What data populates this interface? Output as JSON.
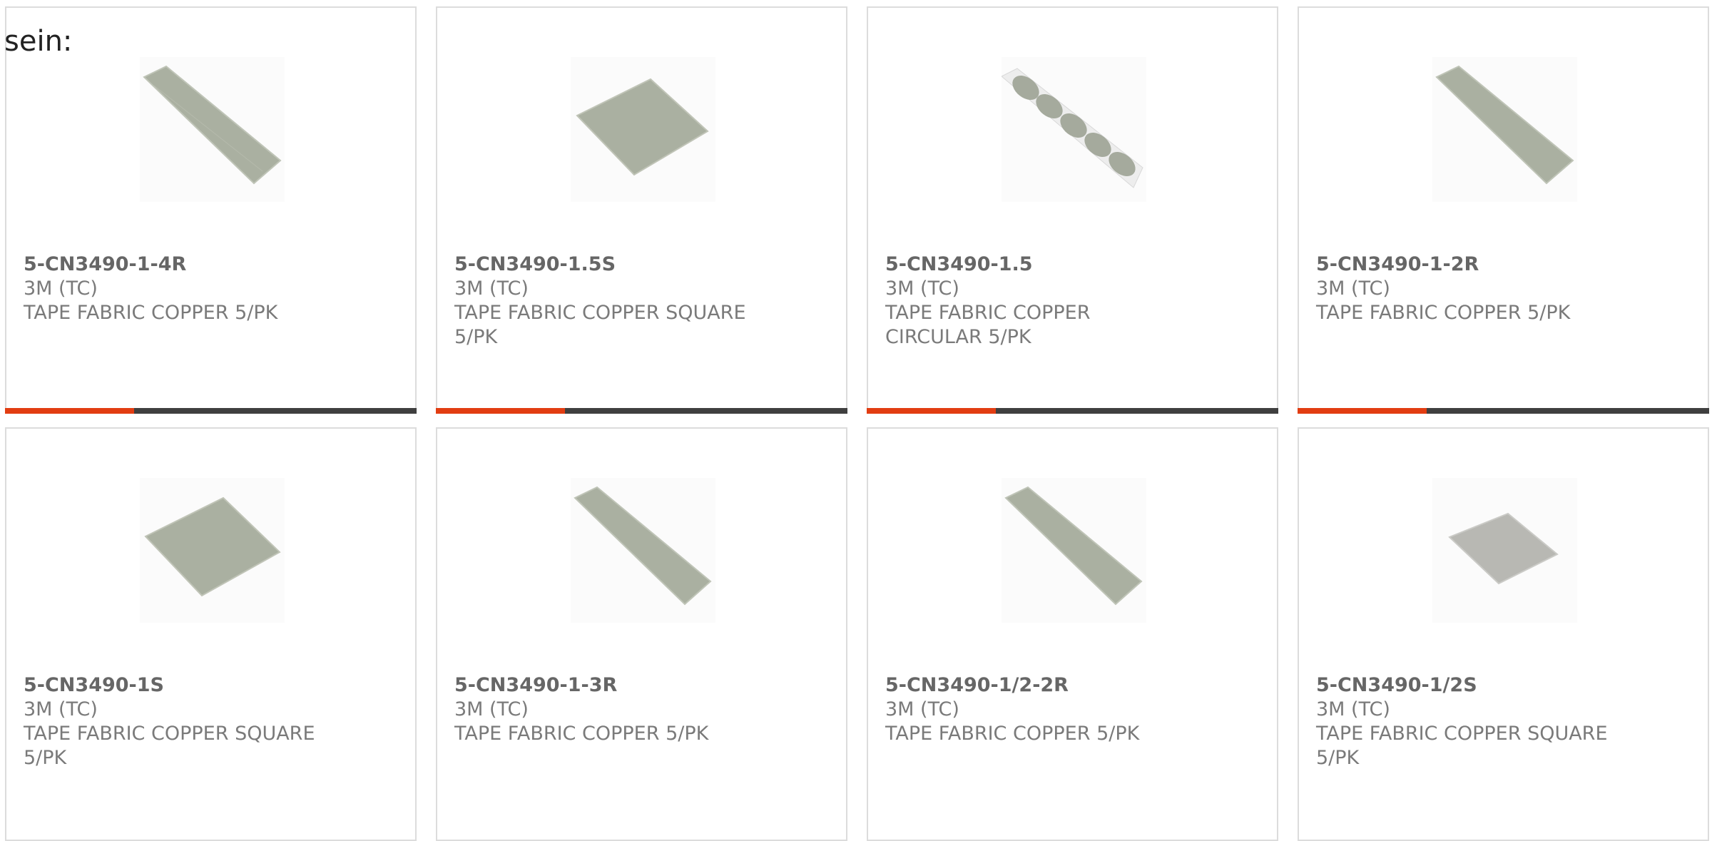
{
  "page": {
    "lead_text": "sein:"
  },
  "colors": {
    "accent": "#e23d12",
    "bar": "#3f3f3f",
    "card_border": "#dcdcdc",
    "text": "#7a7a7a"
  },
  "products": [
    {
      "part_number": "5-CN3490-1-4R",
      "manufacturer": "3M (TC)",
      "description": "TAPE FABRIC COPPER 5/PK",
      "image": "copper-fabric-strip-image",
      "has_accent_bar": true
    },
    {
      "part_number": "5-CN3490-1.5S",
      "manufacturer": "3M (TC)",
      "description": "TAPE FABRIC COPPER SQUARE 5/PK",
      "image": "copper-fabric-square-image",
      "has_accent_bar": true
    },
    {
      "part_number": "5-CN3490-1.5",
      "manufacturer": "3M (TC)",
      "description": "TAPE FABRIC COPPER CIRCULAR 5/PK",
      "image": "copper-fabric-circles-image",
      "has_accent_bar": true
    },
    {
      "part_number": "5-CN3490-1-2R",
      "manufacturer": "3M (TC)",
      "description": "TAPE FABRIC COPPER 5/PK",
      "image": "copper-fabric-strip-image",
      "has_accent_bar": true
    },
    {
      "part_number": "5-CN3490-1S",
      "manufacturer": "3M (TC)",
      "description": "TAPE FABRIC COPPER SQUARE 5/PK",
      "image": "copper-fabric-square-image",
      "has_accent_bar": false
    },
    {
      "part_number": "5-CN3490-1-3R",
      "manufacturer": "3M (TC)",
      "description": "TAPE FABRIC COPPER 5/PK",
      "image": "copper-fabric-strip-image",
      "has_accent_bar": false
    },
    {
      "part_number": "5-CN3490-1/2-2R",
      "manufacturer": "3M (TC)",
      "description": "TAPE FABRIC COPPER 5/PK",
      "image": "copper-fabric-strip-image",
      "has_accent_bar": false
    },
    {
      "part_number": "5-CN3490-1/2S",
      "manufacturer": "3M (TC)",
      "description": "TAPE FABRIC COPPER SQUARE 5/PK",
      "image": "copper-fabric-small-square-image",
      "has_accent_bar": false
    }
  ]
}
